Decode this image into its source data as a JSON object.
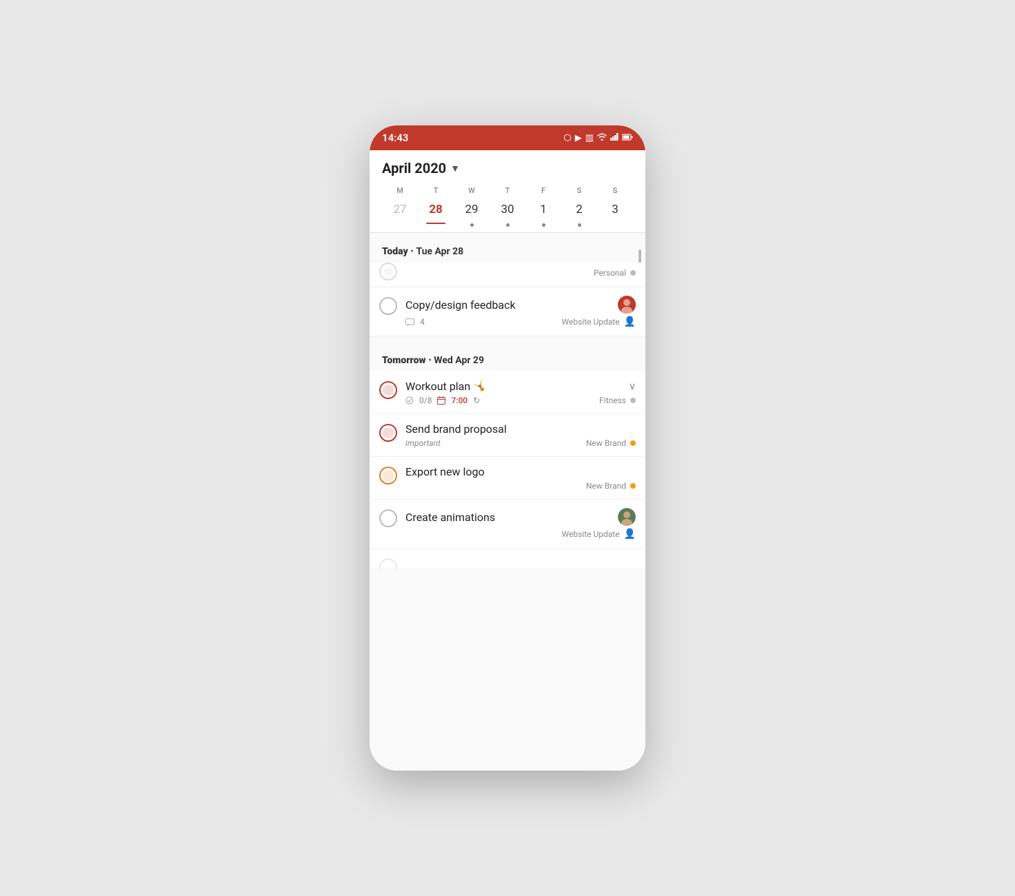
{
  "statusBar": {
    "time": "14:43",
    "icons": [
      "video-icon",
      "cast-icon",
      "vibrate-icon",
      "wifi-icon",
      "signal-icon",
      "battery-icon"
    ]
  },
  "calendar": {
    "monthTitle": "April 2020",
    "weekDays": [
      {
        "letter": "M",
        "num": "27",
        "muted": true,
        "hasDot": false
      },
      {
        "letter": "T",
        "num": "28",
        "today": true,
        "hasDot": false
      },
      {
        "letter": "W",
        "num": "29",
        "hasDot": true
      },
      {
        "letter": "T",
        "num": "30",
        "hasDot": true
      },
      {
        "letter": "F",
        "num": "1",
        "hasDot": true
      },
      {
        "letter": "S",
        "num": "2",
        "hasDot": true
      },
      {
        "letter": "S",
        "num": "3",
        "hasDot": false
      }
    ]
  },
  "sections": [
    {
      "title": "Today",
      "dateSep": "•",
      "dateLabel": "Tue Apr 28",
      "tasks": [
        {
          "id": "personal-task",
          "name": "",
          "checkboxStyle": "normal",
          "projectLabel": "Personal",
          "projectDotColor": "gray",
          "showAvatar": false,
          "showSharedIcon": false,
          "partialTop": true
        },
        {
          "id": "copy-design",
          "name": "Copy/design feedback",
          "checkboxStyle": "normal",
          "commentCount": "4",
          "projectLabel": "Website Update",
          "projectDotColor": "none",
          "showAvatar": true,
          "avatarType": "red-person",
          "showSharedIcon": true
        }
      ]
    },
    {
      "title": "Tomorrow",
      "dateSep": "•",
      "dateLabel": "Wed Apr 29",
      "tasks": [
        {
          "id": "workout-plan",
          "name": "Workout plan 🤸",
          "checkboxStyle": "red-ring",
          "subtaskCount": "0/8",
          "time": "7:00",
          "hasRepeat": true,
          "projectLabel": "Fitness",
          "projectDotColor": "gray",
          "showChevron": true,
          "showAvatar": false
        },
        {
          "id": "send-brand-proposal",
          "name": "Send brand proposal",
          "checkboxStyle": "red-ring",
          "subLabel": "important",
          "projectLabel": "New Brand",
          "projectDotColor": "yellow",
          "showAvatar": false
        },
        {
          "id": "export-new-logo",
          "name": "Export new logo",
          "checkboxStyle": "orange-ring",
          "projectLabel": "New Brand",
          "projectDotColor": "yellow",
          "showAvatar": false
        },
        {
          "id": "create-animations",
          "name": "Create animations",
          "checkboxStyle": "normal",
          "projectLabel": "Website Update",
          "projectDotColor": "none",
          "showAvatar": true,
          "avatarType": "green-person",
          "showSharedIcon": true
        }
      ]
    }
  ],
  "labels": {
    "personalLabel": "Personal",
    "websiteUpdateLabel": "Website Update",
    "fitnessLabel": "Fitness",
    "newBrandLabel": "New Brand",
    "importantLabel": "important",
    "commentCount": "4",
    "subtaskCount": "0/8",
    "time": "7:00"
  }
}
